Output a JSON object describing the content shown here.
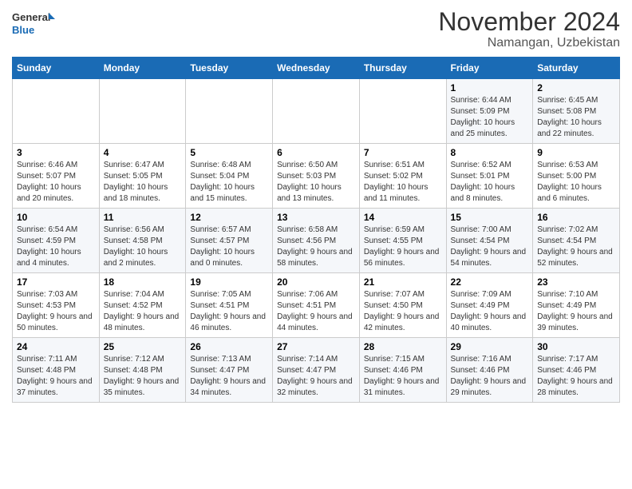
{
  "header": {
    "logo_line1": "General",
    "logo_line2": "Blue",
    "month": "November 2024",
    "location": "Namangan, Uzbekistan"
  },
  "days_of_week": [
    "Sunday",
    "Monday",
    "Tuesday",
    "Wednesday",
    "Thursday",
    "Friday",
    "Saturday"
  ],
  "weeks": [
    [
      {
        "day": "",
        "info": ""
      },
      {
        "day": "",
        "info": ""
      },
      {
        "day": "",
        "info": ""
      },
      {
        "day": "",
        "info": ""
      },
      {
        "day": "",
        "info": ""
      },
      {
        "day": "1",
        "info": "Sunrise: 6:44 AM\nSunset: 5:09 PM\nDaylight: 10 hours and 25 minutes."
      },
      {
        "day": "2",
        "info": "Sunrise: 6:45 AM\nSunset: 5:08 PM\nDaylight: 10 hours and 22 minutes."
      }
    ],
    [
      {
        "day": "3",
        "info": "Sunrise: 6:46 AM\nSunset: 5:07 PM\nDaylight: 10 hours and 20 minutes."
      },
      {
        "day": "4",
        "info": "Sunrise: 6:47 AM\nSunset: 5:05 PM\nDaylight: 10 hours and 18 minutes."
      },
      {
        "day": "5",
        "info": "Sunrise: 6:48 AM\nSunset: 5:04 PM\nDaylight: 10 hours and 15 minutes."
      },
      {
        "day": "6",
        "info": "Sunrise: 6:50 AM\nSunset: 5:03 PM\nDaylight: 10 hours and 13 minutes."
      },
      {
        "day": "7",
        "info": "Sunrise: 6:51 AM\nSunset: 5:02 PM\nDaylight: 10 hours and 11 minutes."
      },
      {
        "day": "8",
        "info": "Sunrise: 6:52 AM\nSunset: 5:01 PM\nDaylight: 10 hours and 8 minutes."
      },
      {
        "day": "9",
        "info": "Sunrise: 6:53 AM\nSunset: 5:00 PM\nDaylight: 10 hours and 6 minutes."
      }
    ],
    [
      {
        "day": "10",
        "info": "Sunrise: 6:54 AM\nSunset: 4:59 PM\nDaylight: 10 hours and 4 minutes."
      },
      {
        "day": "11",
        "info": "Sunrise: 6:56 AM\nSunset: 4:58 PM\nDaylight: 10 hours and 2 minutes."
      },
      {
        "day": "12",
        "info": "Sunrise: 6:57 AM\nSunset: 4:57 PM\nDaylight: 10 hours and 0 minutes."
      },
      {
        "day": "13",
        "info": "Sunrise: 6:58 AM\nSunset: 4:56 PM\nDaylight: 9 hours and 58 minutes."
      },
      {
        "day": "14",
        "info": "Sunrise: 6:59 AM\nSunset: 4:55 PM\nDaylight: 9 hours and 56 minutes."
      },
      {
        "day": "15",
        "info": "Sunrise: 7:00 AM\nSunset: 4:54 PM\nDaylight: 9 hours and 54 minutes."
      },
      {
        "day": "16",
        "info": "Sunrise: 7:02 AM\nSunset: 4:54 PM\nDaylight: 9 hours and 52 minutes."
      }
    ],
    [
      {
        "day": "17",
        "info": "Sunrise: 7:03 AM\nSunset: 4:53 PM\nDaylight: 9 hours and 50 minutes."
      },
      {
        "day": "18",
        "info": "Sunrise: 7:04 AM\nSunset: 4:52 PM\nDaylight: 9 hours and 48 minutes."
      },
      {
        "day": "19",
        "info": "Sunrise: 7:05 AM\nSunset: 4:51 PM\nDaylight: 9 hours and 46 minutes."
      },
      {
        "day": "20",
        "info": "Sunrise: 7:06 AM\nSunset: 4:51 PM\nDaylight: 9 hours and 44 minutes."
      },
      {
        "day": "21",
        "info": "Sunrise: 7:07 AM\nSunset: 4:50 PM\nDaylight: 9 hours and 42 minutes."
      },
      {
        "day": "22",
        "info": "Sunrise: 7:09 AM\nSunset: 4:49 PM\nDaylight: 9 hours and 40 minutes."
      },
      {
        "day": "23",
        "info": "Sunrise: 7:10 AM\nSunset: 4:49 PM\nDaylight: 9 hours and 39 minutes."
      }
    ],
    [
      {
        "day": "24",
        "info": "Sunrise: 7:11 AM\nSunset: 4:48 PM\nDaylight: 9 hours and 37 minutes."
      },
      {
        "day": "25",
        "info": "Sunrise: 7:12 AM\nSunset: 4:48 PM\nDaylight: 9 hours and 35 minutes."
      },
      {
        "day": "26",
        "info": "Sunrise: 7:13 AM\nSunset: 4:47 PM\nDaylight: 9 hours and 34 minutes."
      },
      {
        "day": "27",
        "info": "Sunrise: 7:14 AM\nSunset: 4:47 PM\nDaylight: 9 hours and 32 minutes."
      },
      {
        "day": "28",
        "info": "Sunrise: 7:15 AM\nSunset: 4:46 PM\nDaylight: 9 hours and 31 minutes."
      },
      {
        "day": "29",
        "info": "Sunrise: 7:16 AM\nSunset: 4:46 PM\nDaylight: 9 hours and 29 minutes."
      },
      {
        "day": "30",
        "info": "Sunrise: 7:17 AM\nSunset: 4:46 PM\nDaylight: 9 hours and 28 minutes."
      }
    ]
  ]
}
